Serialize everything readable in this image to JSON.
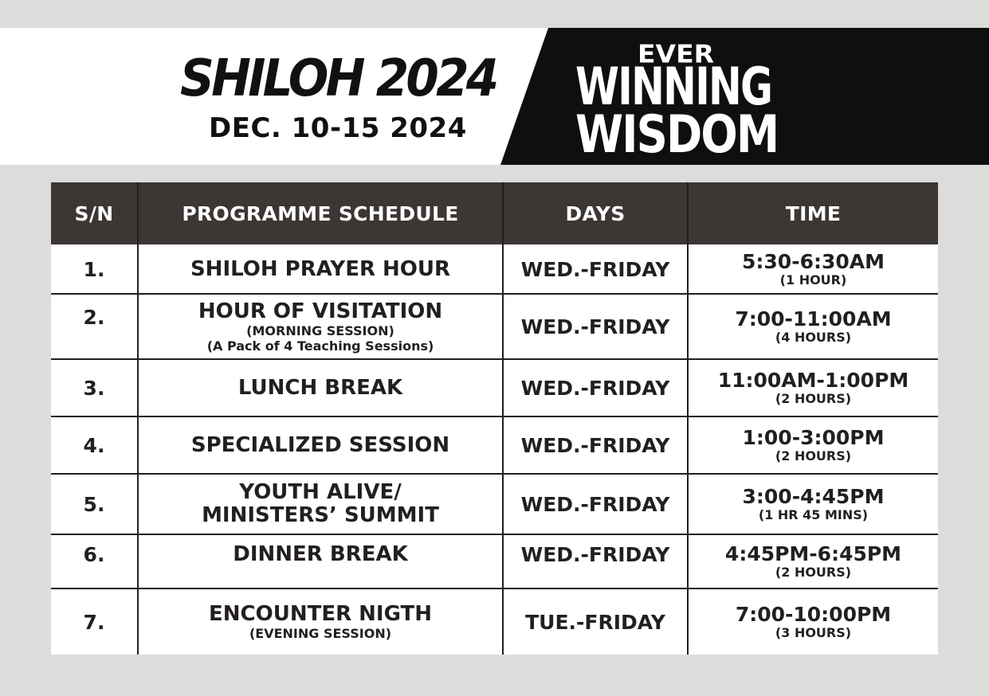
{
  "banner": {
    "event_title": "SHILOH 2024",
    "event_dates": "DEC. 10-15 2024",
    "theme_line1": "EVER",
    "theme_line2": "WINNING",
    "theme_line3": "WISDOM",
    "colors": {
      "light_bg": "#ffffff",
      "dark_bg": "#0f0f0f",
      "page_bg": "#dcdcda"
    }
  },
  "table": {
    "headers": {
      "sn": "S/N",
      "programme": "PROGRAMME SCHEDULE",
      "days": "DAYS",
      "time": "TIME"
    },
    "header_color": "#3c3634",
    "rows": [
      {
        "sn": "1.",
        "programme": "SHILOH PRAYER HOUR",
        "programme_sub": "",
        "programme_sub2": "",
        "days": "WED.-FRIDAY",
        "time": "5:30-6:30AM",
        "duration": "(1 HOUR)"
      },
      {
        "sn": "2.",
        "programme": "HOUR OF VISITATION",
        "programme_sub": "(MORNING SESSION)",
        "programme_sub2": "(A Pack of 4 Teaching Sessions)",
        "days": "WED.-FRIDAY",
        "time": "7:00-11:00AM",
        "duration": "(4 HOURS)"
      },
      {
        "sn": "3.",
        "programme": "LUNCH BREAK",
        "programme_sub": "",
        "programme_sub2": "",
        "days": "WED.-FRIDAY",
        "time": "11:00AM-1:00PM",
        "duration": "(2 HOURS)"
      },
      {
        "sn": "4.",
        "programme": "SPECIALIZED SESSION",
        "programme_sub": "",
        "programme_sub2": "",
        "days": "WED.-FRIDAY",
        "time": "1:00-3:00PM",
        "duration": "(2 HOURS)"
      },
      {
        "sn": "5.",
        "programme": "YOUTH ALIVE/",
        "programme_line2": "MINISTERS’ SUMMIT",
        "programme_sub": "",
        "programme_sub2": "",
        "days": "WED.-FRIDAY",
        "time": "3:00-4:45PM",
        "duration": "(1 HR 45 MINS)"
      },
      {
        "sn": "6.",
        "programme": "DINNER BREAK",
        "programme_sub": "",
        "programme_sub2": "",
        "days": "WED.-FRIDAY",
        "time": "4:45PM-6:45PM",
        "duration": "(2 HOURS)"
      },
      {
        "sn": "7.",
        "programme": "ENCOUNTER NIGTH",
        "programme_sub": "(EVENING SESSION)",
        "programme_sub2": "",
        "days": "TUE.-FRIDAY",
        "time": "7:00-10:00PM",
        "duration": "(3 HOURS)"
      }
    ]
  }
}
